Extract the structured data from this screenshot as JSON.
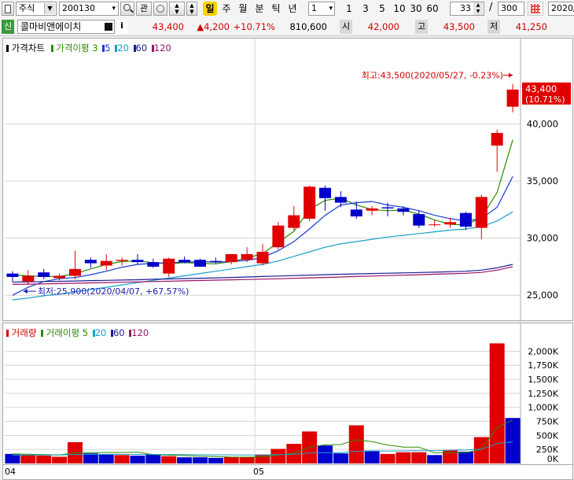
{
  "toolbar": {
    "market": "주식",
    "code": "200130",
    "interest_label": "관",
    "period_buttons": [
      "일",
      "주",
      "월",
      "분",
      "틱",
      "년"
    ],
    "selected_period": "일",
    "multiplier": "1",
    "quick_counts": [
      "1",
      "3",
      "5",
      "10",
      "30",
      "60"
    ],
    "visible_count": "33",
    "separator": "/",
    "total_count": "300",
    "date": "2020/"
  },
  "quote": {
    "badge": "신",
    "name": "콜마비앤에이치",
    "info_icon": "i",
    "price": "43,400",
    "change": "▲4,200",
    "change_pct": "+10.71%",
    "volume": "810,600",
    "open_label": "시",
    "open": "42,000",
    "high_label": "고",
    "high": "43,500",
    "low_label": "저",
    "low": "41,250"
  },
  "price_panel": {
    "legend_title": "가격차트",
    "ma_legend": "가격이평",
    "ma_periods": [
      "3",
      "5",
      "20",
      "60",
      "120"
    ],
    "ma_colors": [
      "#2e8b00",
      "#1a3cd0",
      "#17a0c8",
      "#1d1d96",
      "#9a1464"
    ],
    "high_annotation": "최고:43,500(2020/05/27, -0.23%)",
    "low_annotation": "최저:25,900(2020/04/07, +67.57%)",
    "last_price_label": "43,400",
    "last_pct_label": "(10.71%)"
  },
  "volume_panel": {
    "legend_title": "거래량",
    "ma_legend": "거래이평",
    "ma_periods": [
      "5",
      "20",
      "60",
      "120"
    ]
  },
  "x_labels": [
    "04",
    "05"
  ],
  "colors": {
    "up": "#e00000",
    "down": "#0000cc",
    "grid": "#d4d4d4",
    "label_bg": "#e00000"
  },
  "chart_data": [
    {
      "type": "candlestick",
      "title": "가격차트",
      "ylim": [
        23500,
        46500
      ],
      "yticks": [
        25000,
        30000,
        35000,
        40000
      ],
      "ytick_labels": [
        "25,000",
        "30,000",
        "35,000",
        "40,000"
      ],
      "x_month_starts": [
        {
          "index": 0,
          "label": "04"
        },
        {
          "index": 16,
          "label": "05"
        }
      ],
      "candles": [
        {
          "o": 26900,
          "h": 27100,
          "l": 26200,
          "c": 26600
        },
        {
          "o": 26200,
          "h": 27200,
          "l": 25900,
          "c": 26700
        },
        {
          "o": 27000,
          "h": 27300,
          "l": 26400,
          "c": 26600
        },
        {
          "o": 26500,
          "h": 26900,
          "l": 26300,
          "c": 26700
        },
        {
          "o": 26700,
          "h": 28900,
          "l": 26400,
          "c": 27300
        },
        {
          "o": 28100,
          "h": 28300,
          "l": 27400,
          "c": 27800
        },
        {
          "o": 27600,
          "h": 28600,
          "l": 27200,
          "c": 28000
        },
        {
          "o": 28000,
          "h": 28300,
          "l": 27600,
          "c": 28100
        },
        {
          "o": 28100,
          "h": 28600,
          "l": 27700,
          "c": 27900
        },
        {
          "o": 27900,
          "h": 28200,
          "l": 27400,
          "c": 27500
        },
        {
          "o": 26900,
          "h": 28300,
          "l": 26600,
          "c": 28200
        },
        {
          "o": 28100,
          "h": 28400,
          "l": 27800,
          "c": 27900
        },
        {
          "o": 28100,
          "h": 28200,
          "l": 27500,
          "c": 27500
        },
        {
          "o": 28000,
          "h": 28300,
          "l": 27800,
          "c": 27900
        },
        {
          "o": 27900,
          "h": 28600,
          "l": 27700,
          "c": 28600
        },
        {
          "o": 28100,
          "h": 29200,
          "l": 27900,
          "c": 28600
        },
        {
          "o": 27800,
          "h": 29500,
          "l": 27600,
          "c": 28800
        },
        {
          "o": 29200,
          "h": 31400,
          "l": 29000,
          "c": 31100
        },
        {
          "o": 30900,
          "h": 32800,
          "l": 30700,
          "c": 32000
        },
        {
          "o": 31700,
          "h": 34600,
          "l": 31500,
          "c": 34500
        },
        {
          "o": 34400,
          "h": 34600,
          "l": 32400,
          "c": 33500
        },
        {
          "o": 33600,
          "h": 34100,
          "l": 32700,
          "c": 33100
        },
        {
          "o": 32500,
          "h": 33200,
          "l": 31700,
          "c": 31900
        },
        {
          "o": 32400,
          "h": 32800,
          "l": 32000,
          "c": 32600
        },
        {
          "o": 32700,
          "h": 33100,
          "l": 31900,
          "c": 32600
        },
        {
          "o": 32600,
          "h": 32800,
          "l": 32000,
          "c": 32300
        },
        {
          "o": 32100,
          "h": 32400,
          "l": 30900,
          "c": 31100
        },
        {
          "o": 31200,
          "h": 31600,
          "l": 31000,
          "c": 31200
        },
        {
          "o": 31200,
          "h": 31800,
          "l": 30900,
          "c": 31400
        },
        {
          "o": 32200,
          "h": 32300,
          "l": 30700,
          "c": 31000
        },
        {
          "o": 30900,
          "h": 33800,
          "l": 29900,
          "c": 33600
        },
        {
          "o": 38100,
          "h": 39500,
          "l": 35800,
          "c": 39200
        },
        {
          "o": 41500,
          "h": 43500,
          "l": 41000,
          "c": 43000
        }
      ],
      "moving_averages": [
        {
          "name": "3",
          "values": [
            26800,
            26700,
            26650,
            26650,
            26900,
            27300,
            27700,
            27950,
            28000,
            27850,
            27750,
            27850,
            27800,
            27750,
            27950,
            28250,
            28650,
            29600,
            30600,
            32500,
            33300,
            33500,
            32900,
            32500,
            32400,
            32450,
            32100,
            31600,
            31200,
            31150,
            31800,
            34000,
            38600
          ]
        },
        {
          "name": "5",
          "values": [
            25000,
            25700,
            26200,
            26450,
            26550,
            26800,
            27100,
            27450,
            27700,
            27800,
            27850,
            27900,
            27950,
            27900,
            27950,
            28050,
            28300,
            28900,
            29700,
            30800,
            32000,
            32900,
            33100,
            33200,
            32900,
            32700,
            32400,
            32000,
            31700,
            31500,
            31700,
            32700,
            35400
          ]
        },
        {
          "name": "20",
          "values": [
            24600,
            24750,
            24950,
            25100,
            25300,
            25500,
            25700,
            25900,
            26100,
            26300,
            26500,
            26700,
            26900,
            27100,
            27300,
            27500,
            27700,
            28000,
            28400,
            28800,
            29200,
            29500,
            29700,
            29900,
            30100,
            30250,
            30400,
            30550,
            30700,
            30800,
            31000,
            31500,
            32300
          ]
        },
        {
          "name": "60",
          "values": [
            26150,
            26170,
            26200,
            26220,
            26250,
            26280,
            26300,
            26330,
            26360,
            26400,
            26430,
            26460,
            26490,
            26520,
            26560,
            26600,
            26640,
            26680,
            26720,
            26760,
            26800,
            26840,
            26870,
            26900,
            26930,
            26960,
            26990,
            27020,
            27060,
            27100,
            27200,
            27400,
            27700
          ]
        },
        {
          "name": "120",
          "values": [
            25950,
            25970,
            25990,
            26020,
            26050,
            26080,
            26110,
            26140,
            26170,
            26200,
            26230,
            26260,
            26290,
            26320,
            26350,
            26380,
            26410,
            26440,
            26480,
            26520,
            26560,
            26600,
            26640,
            26680,
            26720,
            26760,
            26800,
            26840,
            26880,
            26920,
            27000,
            27200,
            27500
          ]
        }
      ]
    },
    {
      "type": "bar",
      "title": "거래량",
      "ylim": [
        0,
        2300000
      ],
      "yticks": [
        250000,
        500000,
        750000,
        1000000,
        1250000,
        1500000,
        1750000,
        2000000
      ],
      "ytick_labels": [
        "250K",
        "500K",
        "750K",
        "1,000K",
        "1,250K",
        "1,500K",
        "1,750K",
        "2,000K"
      ],
      "zero_label": "0K",
      "values": [
        170000,
        150000,
        140000,
        120000,
        380000,
        180000,
        160000,
        150000,
        140000,
        160000,
        130000,
        110000,
        110000,
        100000,
        120000,
        120000,
        160000,
        260000,
        350000,
        570000,
        320000,
        180000,
        680000,
        230000,
        170000,
        200000,
        200000,
        150000,
        240000,
        210000,
        470000,
        2140000,
        810600
      ],
      "up": [
        false,
        true,
        true,
        true,
        true,
        false,
        false,
        true,
        false,
        false,
        true,
        false,
        false,
        false,
        true,
        true,
        true,
        true,
        true,
        true,
        false,
        false,
        true,
        false,
        true,
        true,
        true,
        false,
        true,
        false,
        true,
        true,
        false
      ],
      "moving_averages": [
        {
          "name": "5",
          "values": [
            170000,
            165000,
            160000,
            150000,
            192000,
            194000,
            196000,
            196000,
            202000,
            158000,
            148000,
            140000,
            130000,
            124000,
            114000,
            112000,
            118000,
            152000,
            182000,
            292000,
            332000,
            336000,
            422000,
            388000,
            330000,
            292000,
            292000,
            190000,
            192000,
            194000,
            254000,
            642000,
            774000
          ]
        },
        {
          "name": "20",
          "values": [
            150000,
            151000,
            152000,
            152000,
            160000,
            162000,
            163000,
            162000,
            161000,
            161000,
            160000,
            158000,
            156000,
            154000,
            153000,
            152000,
            151000,
            155000,
            165000,
            185000,
            192000,
            193000,
            218000,
            224000,
            222000,
            224000,
            228000,
            229000,
            236000,
            240000,
            255000,
            355000,
            385000
          ]
        }
      ]
    }
  ]
}
